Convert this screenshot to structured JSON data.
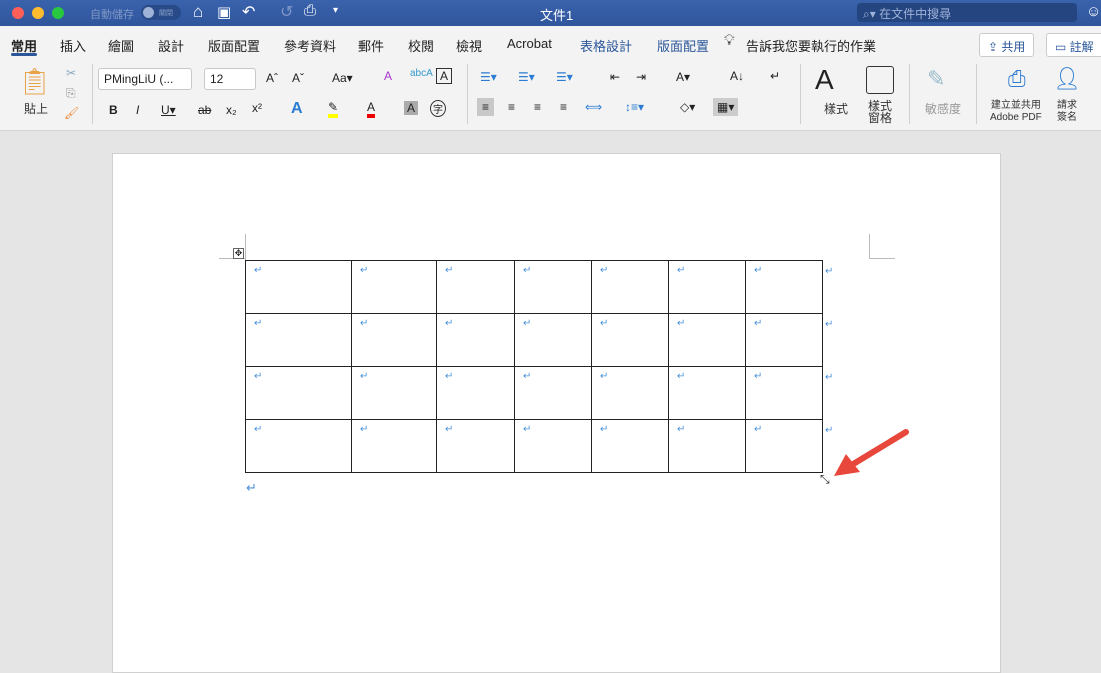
{
  "titlebar": {
    "autosave_label": "自動儲存",
    "autosave_state": "關閉",
    "title": "文件1",
    "search_placeholder": "在文件中搜尋"
  },
  "tabs": [
    {
      "label": "常用",
      "active": true
    },
    {
      "label": "插入"
    },
    {
      "label": "繪圖"
    },
    {
      "label": "設計"
    },
    {
      "label": "版面配置"
    },
    {
      "label": "參考資料"
    },
    {
      "label": "郵件"
    },
    {
      "label": "校閱"
    },
    {
      "label": "檢視"
    },
    {
      "label": "Acrobat"
    },
    {
      "label": "表格設計",
      "context": true
    },
    {
      "label": "版面配置",
      "context": true
    }
  ],
  "tell_me": "告訴我您要執行的作業",
  "share_label": "共用",
  "comments_label": "註解",
  "ribbon": {
    "paste": "貼上",
    "font_name": "PMingLiU (...",
    "font_size": "12",
    "styles": "樣式",
    "styles_pane_1": "樣式",
    "styles_pane_2": "窗格",
    "sensitivity": "敏感度",
    "adobe_1": "建立並共用",
    "adobe_2": "Adobe PDF",
    "sign_1": "請求",
    "sign_2": "簽名"
  },
  "table": {
    "rows": 4,
    "cols": 7,
    "cell_mark": "↵"
  },
  "accent": "#2b579a",
  "arrow_color": "#e8483b"
}
